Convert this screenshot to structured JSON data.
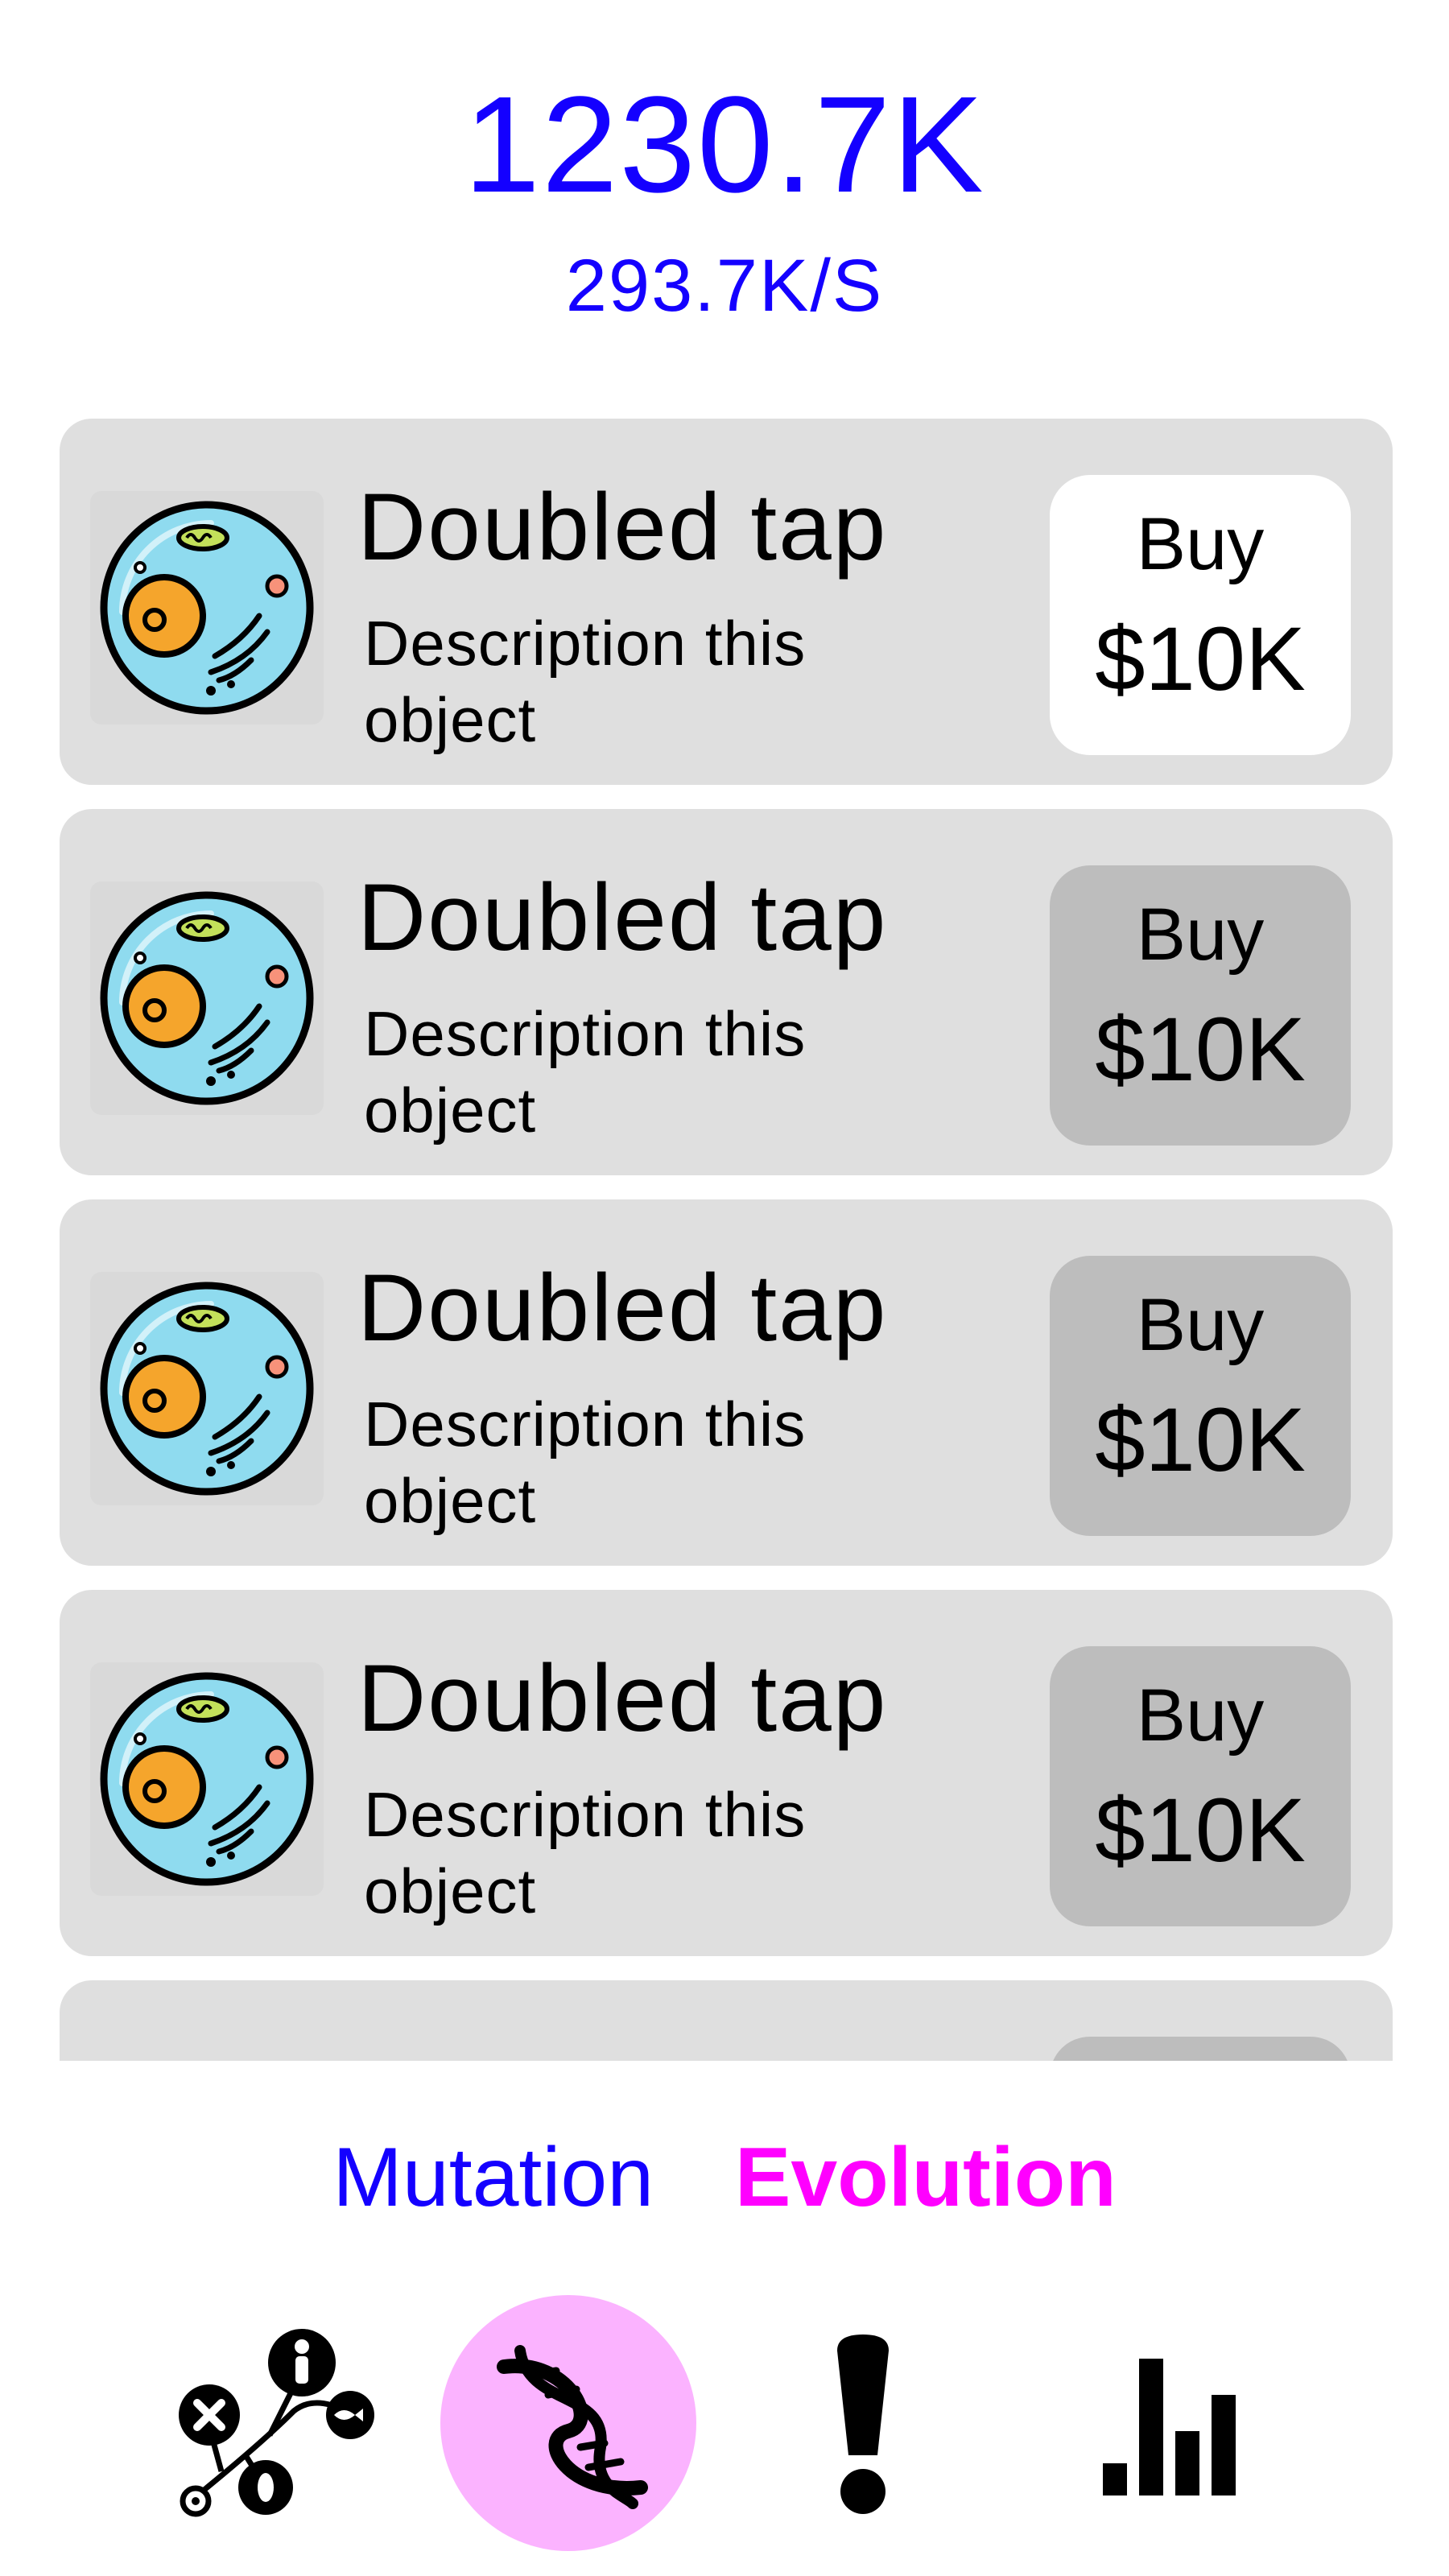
{
  "header": {
    "score": "1230.7K",
    "rate": "293.7K/S"
  },
  "items": [
    {
      "title": "Doubled tap",
      "description": "Description this object",
      "buy_label": "Buy",
      "price": "$10K",
      "affordable": true,
      "icon": "cell-icon"
    },
    {
      "title": "Doubled tap",
      "description": "Description this object",
      "buy_label": "Buy",
      "price": "$10K",
      "affordable": false,
      "icon": "cell-icon"
    },
    {
      "title": "Doubled tap",
      "description": "Description this object",
      "buy_label": "Buy",
      "price": "$10K",
      "affordable": false,
      "icon": "cell-icon"
    },
    {
      "title": "Doubled tap",
      "description": "Description this object",
      "buy_label": "Buy",
      "price": "$10K",
      "affordable": false,
      "icon": "cell-icon"
    }
  ],
  "tabs": [
    {
      "label": "Mutation",
      "active": false
    },
    {
      "label": "Evolution",
      "active": true
    }
  ],
  "nav": [
    {
      "icon": "evolution-tree-icon",
      "selected": false
    },
    {
      "icon": "dna-icon",
      "selected": true
    },
    {
      "icon": "exclamation-icon",
      "selected": false
    },
    {
      "icon": "bar-chart-icon",
      "selected": false
    }
  ],
  "colors": {
    "accent_blue": "#1400ff",
    "accent_magenta": "#ff00ff",
    "card_bg": "#dfdfdf",
    "button_disabled": "#bdbdbd",
    "button_active": "#ffffff",
    "nav_selected_bg": "#fbb3ff"
  }
}
